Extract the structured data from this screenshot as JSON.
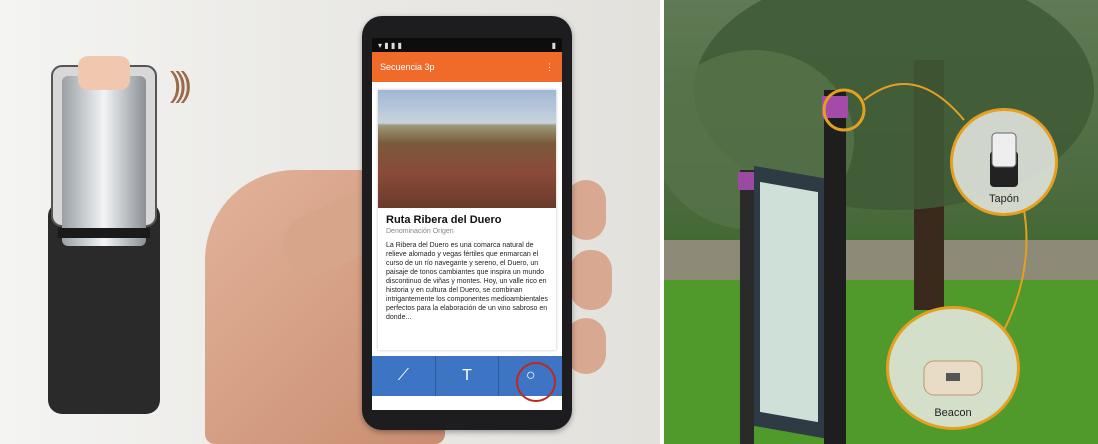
{
  "phone": {
    "status_time": "▾ ▮ ▮ ▮",
    "app_title": "Secuencia 3p",
    "menu_glyph": "⋮",
    "card_title": "Ruta Ribera del Duero",
    "card_subtitle": "Denominación Origen",
    "card_body": "La Ribera del Duero es una comarca natural de relieve alomado y vegas fértiles que enmarcan el curso de un río navegante y sereno, el Duero, un paisaje de tonos cambiantes que inspira un mundo discontinuo de viñas y montes. Hoy, un valle rico en historia y en cultura del Duero, se combinan intrigantemente los componentes medioambientales perfectos para la elaboración de un vino sabroso en donde...",
    "tabs": [
      "⟋",
      "T",
      "○"
    ]
  },
  "labels": {
    "tapon": "Tapón",
    "beacon": "Beacon"
  },
  "colors": {
    "app_orange": "#f06a2a",
    "tab_blue": "#3d74c4",
    "callout": "#e6a020",
    "highlight_ring": "#c0281f"
  }
}
